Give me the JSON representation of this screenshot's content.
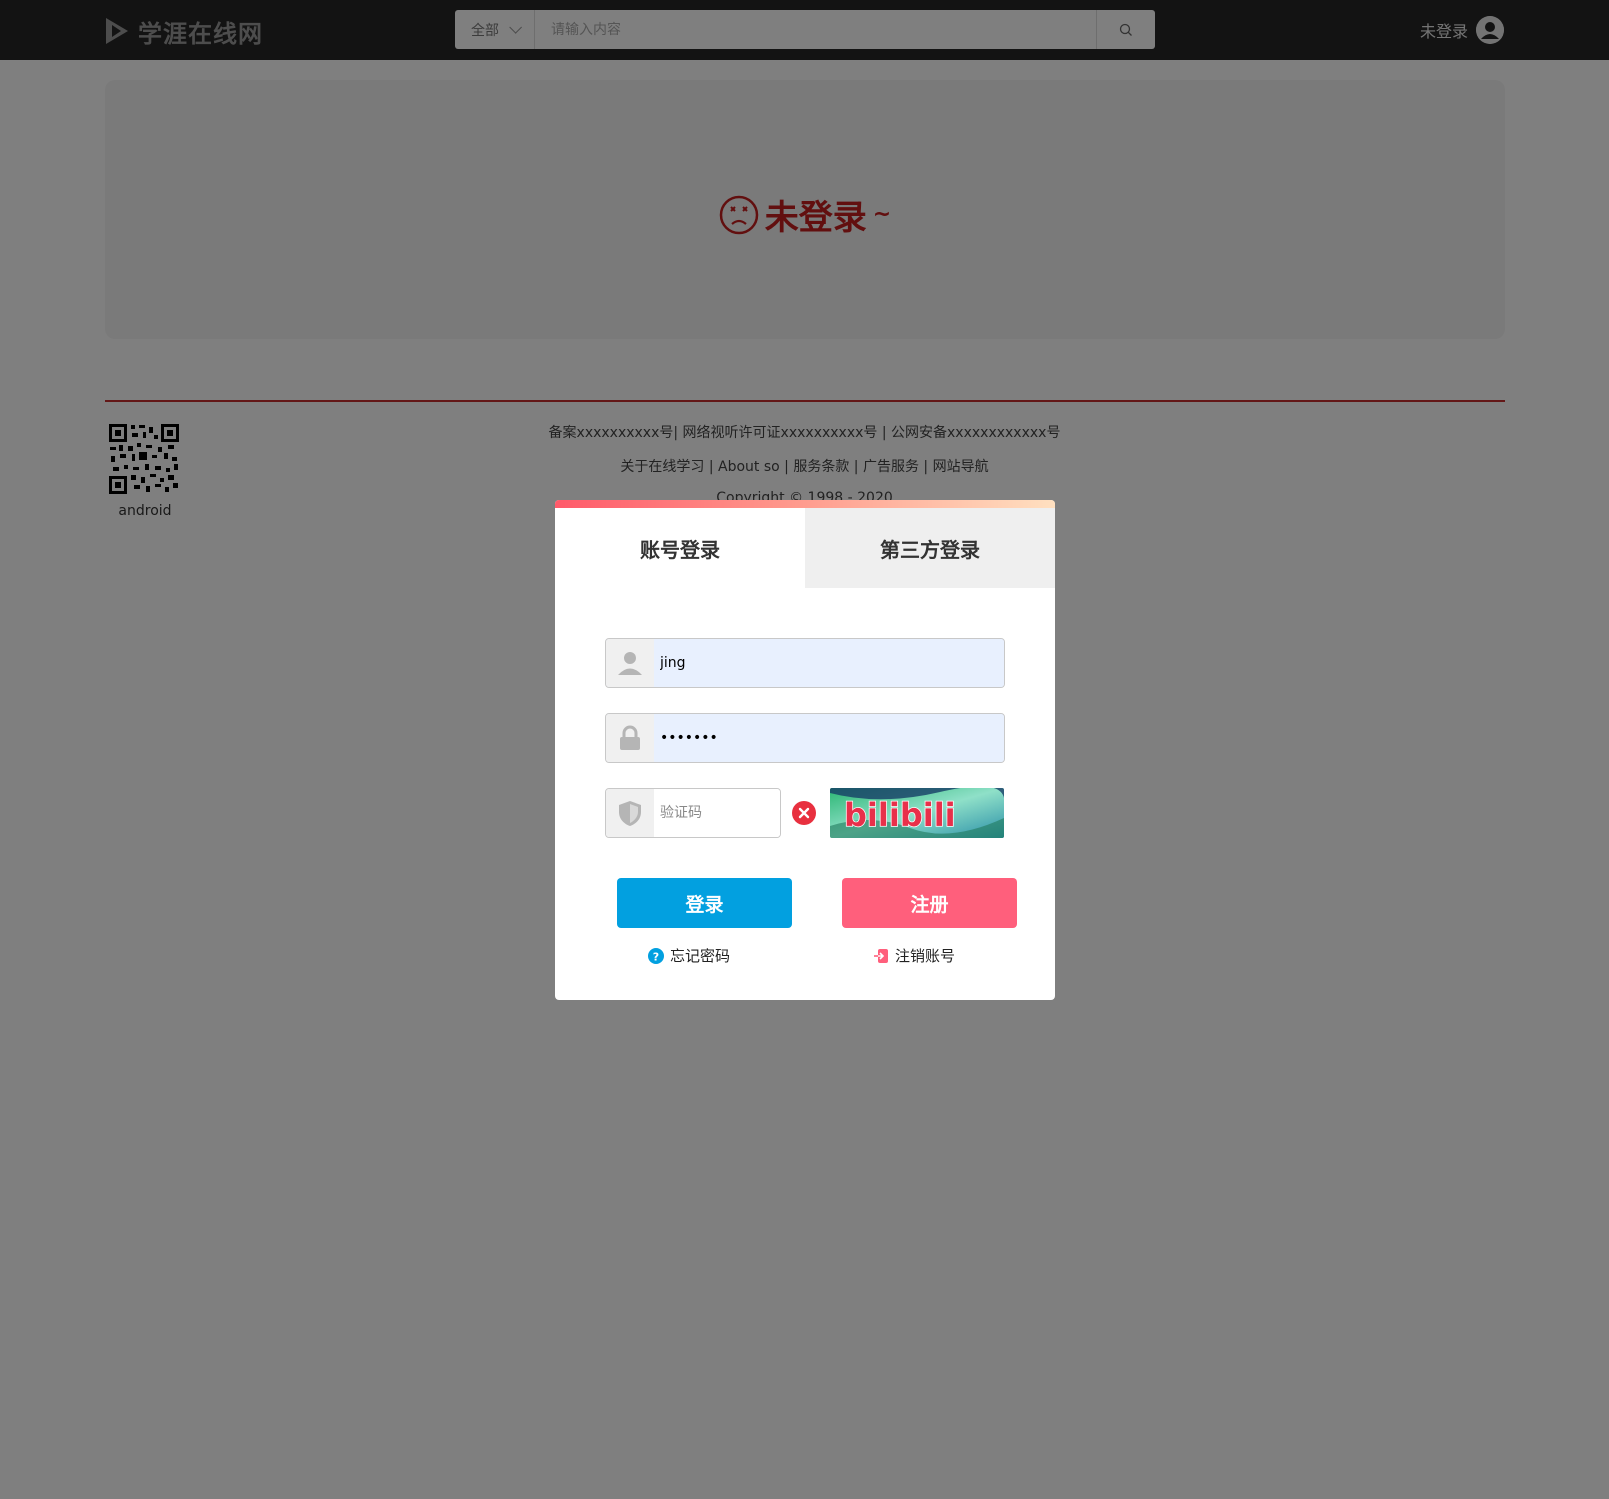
{
  "header": {
    "logo_text": "学涯在线网",
    "search": {
      "category": "全部",
      "placeholder": "请输入内容"
    },
    "user_status": "未登录"
  },
  "main": {
    "not_logged_text": "未登录",
    "not_logged_tilde": "~"
  },
  "footer": {
    "qr_label": "android",
    "line1": "备案xxxxxxxxxx号| 网络视听许可证xxxxxxxxxx号 | 公网安备xxxxxxxxxxxx号",
    "line2": "关于在线学习 | About so | 服务条款 | 广告服务 | 网站导航",
    "line3": "Copyright © 1998 - 2020"
  },
  "login_modal": {
    "tabs": [
      "账号登录",
      "第三方登录"
    ],
    "username_value": "jing",
    "password_value": "•••••••",
    "captcha_placeholder": "验证码",
    "captcha_image_text": "bilibili",
    "login_button": "登录",
    "register_button": "注册",
    "forgot_password": "忘记密码",
    "cancel_account": "注销账号"
  },
  "colors": {
    "header_bg": "#262626",
    "accent_red": "#c41e1e",
    "login_blue": "#02a0e0",
    "register_pink": "#ff5f7c",
    "error_red": "#e8303f"
  },
  "icons": [
    "play-logo-icon",
    "chevron-down-icon",
    "search-icon",
    "user-avatar-icon",
    "sad-face-icon",
    "qr-code-icon",
    "user-icon",
    "lock-icon",
    "shield-icon",
    "error-close-icon",
    "help-icon",
    "logout-icon"
  ]
}
